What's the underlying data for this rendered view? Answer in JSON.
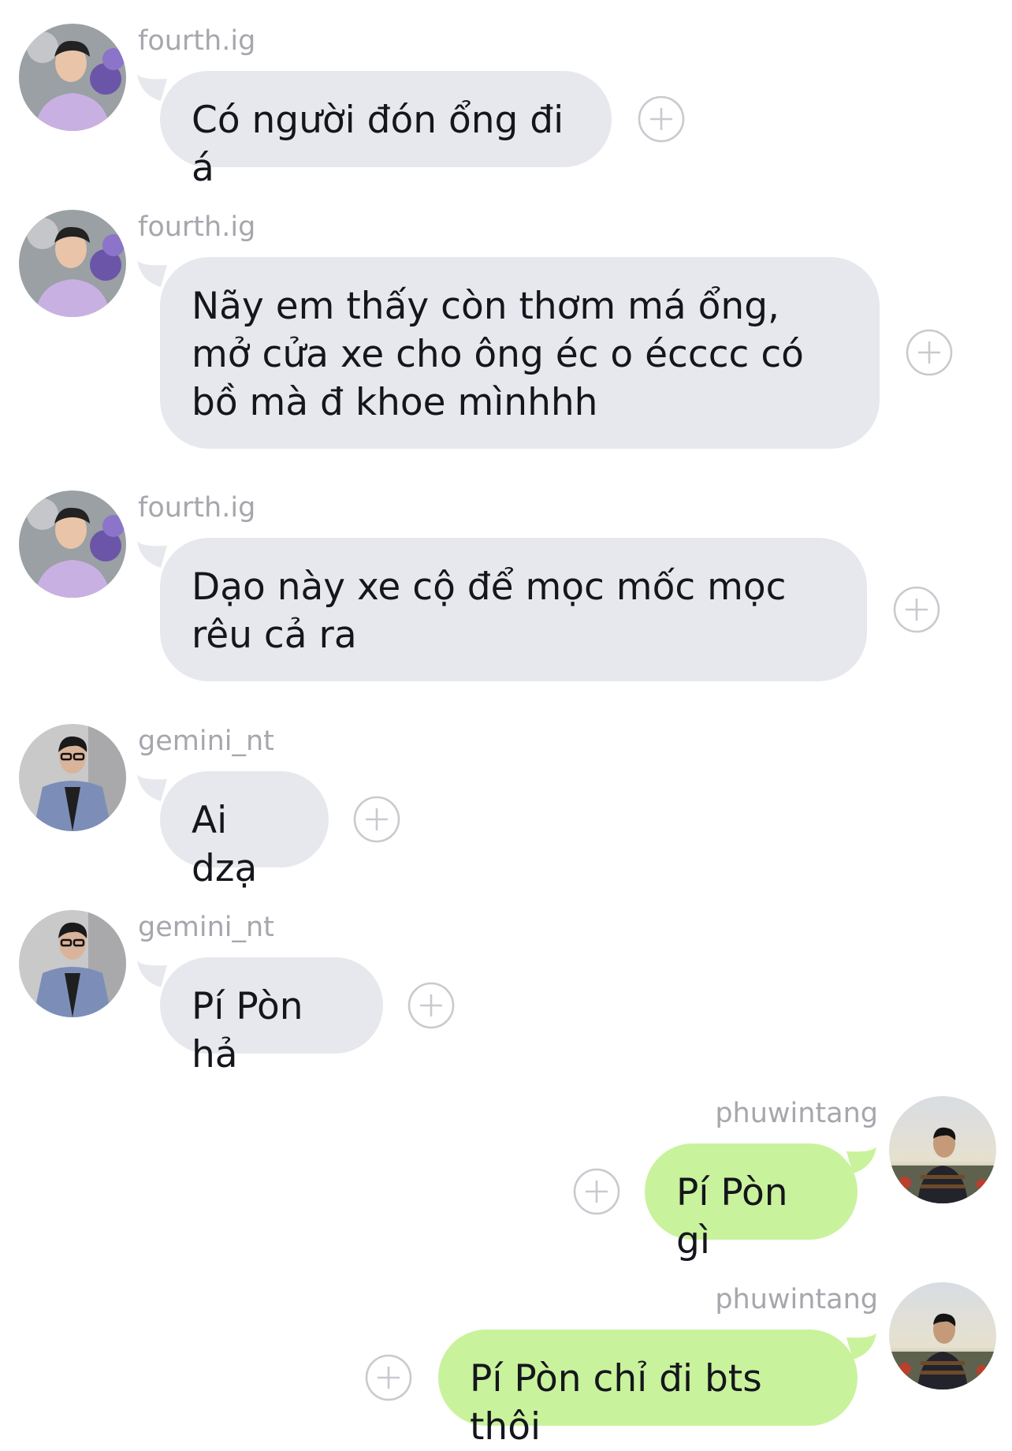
{
  "messages": [
    {
      "sender": "fourth.ig",
      "text": "Có người đón ổng đi á",
      "side": "in",
      "avatar": "avatar-fourth"
    },
    {
      "sender": "fourth.ig",
      "text": "Nãy em thấy còn thơm má ổng, mở cửa xe cho ông éc o écccc có bồ mà đ khoe mìnhhh",
      "side": "in",
      "avatar": "avatar-fourth"
    },
    {
      "sender": "fourth.ig",
      "text": "Dạo này xe cộ để mọc mốc mọc rêu cả ra",
      "side": "in",
      "avatar": "avatar-fourth"
    },
    {
      "sender": "gemini_nt",
      "text": "Ai dzạ",
      "side": "in",
      "avatar": "avatar-gemini"
    },
    {
      "sender": "gemini_nt",
      "text": "Pí Pòn hả",
      "side": "in",
      "avatar": "avatar-gemini"
    },
    {
      "sender": "phuwintang",
      "text": "Pí Pòn gì",
      "side": "out",
      "avatar": "avatar-phuwin"
    },
    {
      "sender": "phuwintang",
      "text": "Pí Pòn chỉ đi bts thôi",
      "side": "out",
      "avatar": "avatar-phuwin"
    }
  ],
  "icons": {
    "add_reaction": "plus-circle-icon"
  },
  "colors": {
    "incoming_bubble": "#e7e8ed",
    "outgoing_bubble": "#c9f29c",
    "sender_name": "#a6a7ad"
  }
}
